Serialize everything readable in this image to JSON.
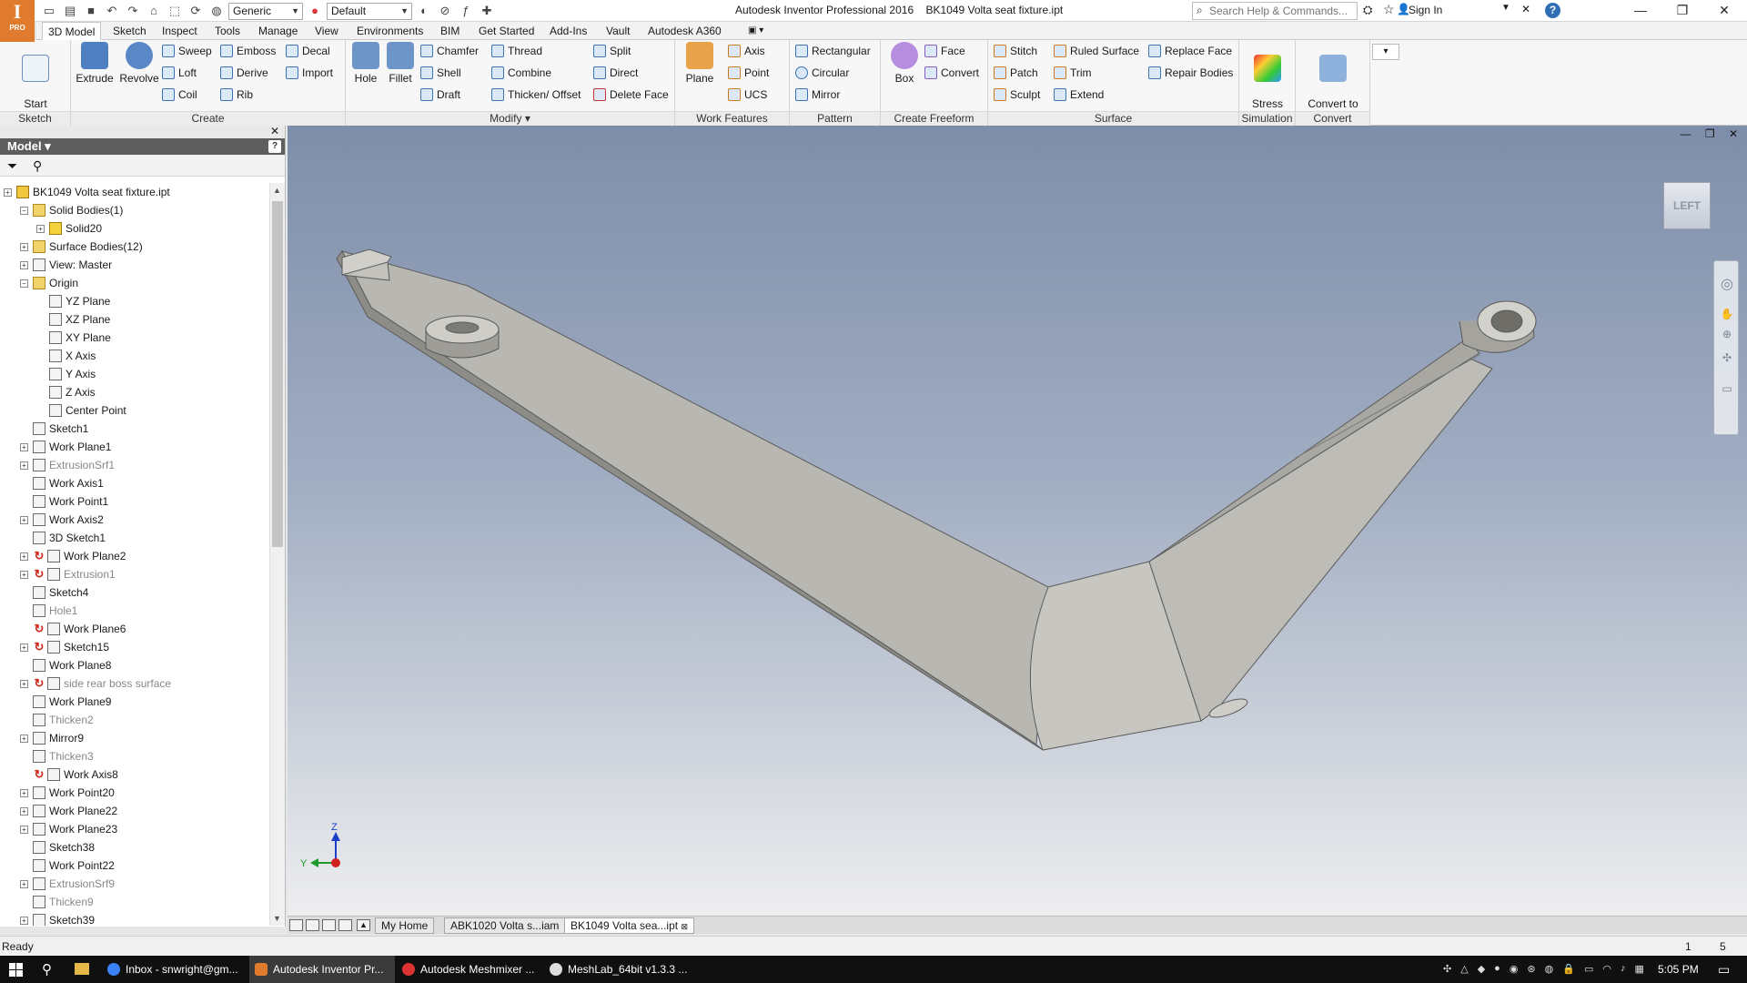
{
  "app": {
    "logo_letter": "I",
    "logo_sub": "PRO",
    "title": "Autodesk Inventor Professional 2016    BK1049 Volta seat fixture.ipt"
  },
  "quick_access": {
    "material": "Generic",
    "appearance": "Default"
  },
  "search": {
    "placeholder": "Search Help & Commands..."
  },
  "user": {
    "sign_in": "Sign In"
  },
  "ribbon_tabs": [
    "3D Model",
    "Sketch",
    "Inspect",
    "Tools",
    "Manage",
    "View",
    "Environments",
    "BIM",
    "Get Started",
    "Add-Ins",
    "Vault",
    "Autodesk A360"
  ],
  "ribbon": {
    "sketch": {
      "label": "Sketch",
      "start_sketch": "Start\n2D Sketch"
    },
    "create": {
      "label": "Create",
      "extrude": "Extrude",
      "revolve": "Revolve",
      "sweep": "Sweep",
      "emboss": "Emboss",
      "decal": "Decal",
      "loft": "Loft",
      "derive": "Derive",
      "import": "Import",
      "coil": "Coil",
      "rib": "Rib"
    },
    "modify": {
      "label": "Modify ▾",
      "hole": "Hole",
      "fillet": "Fillet",
      "chamfer": "Chamfer",
      "thread": "Thread",
      "split": "Split",
      "shell": "Shell",
      "combine": "Combine",
      "direct": "Direct",
      "draft": "Draft",
      "thicken": "Thicken/ Offset",
      "delete_face": "Delete Face"
    },
    "work_features": {
      "label": "Work Features",
      "plane": "Plane",
      "axis": "Axis",
      "point": "Point",
      "ucs": "UCS"
    },
    "pattern": {
      "label": "Pattern",
      "rectangular": "Rectangular",
      "circular": "Circular",
      "mirror": "Mirror"
    },
    "freeform": {
      "label": "Create Freeform",
      "box": "Box",
      "face": "Face",
      "convert": "Convert"
    },
    "surface": {
      "label": "Surface",
      "stitch": "Stitch",
      "ruled": "Ruled Surface",
      "replace": "Replace Face",
      "patch": "Patch",
      "trim": "Trim",
      "repair": "Repair Bodies",
      "sculpt": "Sculpt",
      "extend": "Extend"
    },
    "simulation": {
      "label": "Simulation",
      "stress": "Stress\nAnalysis"
    },
    "convert": {
      "label": "Convert",
      "sheet": "Convert to\nSheet Metal"
    }
  },
  "browser": {
    "title": "Model ▾",
    "nodes": [
      {
        "label": "BK1049 Volta seat fixture.ipt"
      },
      {
        "label": "Solid Bodies(1)"
      },
      {
        "label": "Solid20"
      },
      {
        "label": "Surface Bodies(12)"
      },
      {
        "label": "View: Master"
      },
      {
        "label": "Origin"
      },
      {
        "label": "YZ Plane"
      },
      {
        "label": "XZ Plane"
      },
      {
        "label": "XY Plane"
      },
      {
        "label": "X Axis"
      },
      {
        "label": "Y Axis"
      },
      {
        "label": "Z Axis"
      },
      {
        "label": "Center Point"
      },
      {
        "label": "Sketch1"
      },
      {
        "label": "Work Plane1"
      },
      {
        "label": "ExtrusionSrf1"
      },
      {
        "label": "Work Axis1"
      },
      {
        "label": "Work Point1"
      },
      {
        "label": "Work Axis2"
      },
      {
        "label": "3D Sketch1"
      },
      {
        "label": "Work Plane2"
      },
      {
        "label": "Extrusion1"
      },
      {
        "label": "Sketch4"
      },
      {
        "label": "Hole1"
      },
      {
        "label": "Work Plane6"
      },
      {
        "label": "Sketch15"
      },
      {
        "label": "Work Plane8"
      },
      {
        "label": "side rear boss surface"
      },
      {
        "label": "Work Plane9"
      },
      {
        "label": "Thicken2"
      },
      {
        "label": "Mirror9"
      },
      {
        "label": "Thicken3"
      },
      {
        "label": "Work Axis8"
      },
      {
        "label": "Work Point20"
      },
      {
        "label": "Work Plane22"
      },
      {
        "label": "Work Plane23"
      },
      {
        "label": "Sketch38"
      },
      {
        "label": "Work Point22"
      },
      {
        "label": "ExtrusionSrf9"
      },
      {
        "label": "Thicken9"
      },
      {
        "label": "Sketch39"
      }
    ]
  },
  "viewport": {
    "viewcube_face": "LEFT",
    "triad_z": "Z",
    "triad_y": "Y"
  },
  "doc_tabs": [
    "My Home",
    "ABK1020 Volta s...iam",
    "BK1049 Volta sea...ipt"
  ],
  "status": {
    "text": "Ready",
    "n1": "1",
    "n2": "5"
  },
  "taskbar": {
    "apps": [
      "Inbox - snwright@gm...",
      "Autodesk Inventor Pr...",
      "Autodesk Meshmixer ...",
      "MeshLab_64bit v1.3.3 ..."
    ],
    "clock": "5:05 PM"
  },
  "colors": {
    "accent": "#e07a2c",
    "viewport_top": "#7e8eaa",
    "viewport_bottom": "#eeeef0",
    "model": "#b8b6b0"
  }
}
